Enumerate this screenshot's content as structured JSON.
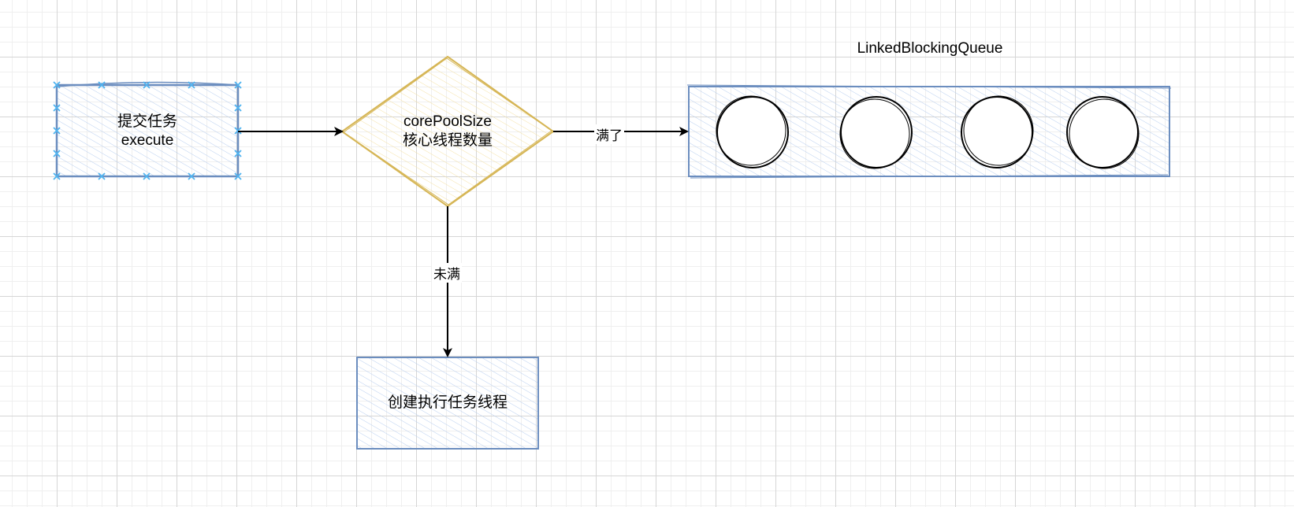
{
  "nodes": {
    "submit": {
      "line1": "提交任务",
      "line2": "execute"
    },
    "decision": {
      "line1": "corePoolSize",
      "line2": "核心线程数量"
    },
    "create_thread": {
      "label": "创建执行任务线程"
    },
    "queue": {
      "title": "LinkedBlockingQueue",
      "slots": 4
    }
  },
  "edges": {
    "full": "满了",
    "not_full": "未满"
  },
  "colors": {
    "blue_stroke": "#6c8ebf",
    "blue_fill": "#dae8fc",
    "yellow_stroke": "#d6b656",
    "yellow_fill": "#fff2cc",
    "selection": "#4fb3f0"
  }
}
